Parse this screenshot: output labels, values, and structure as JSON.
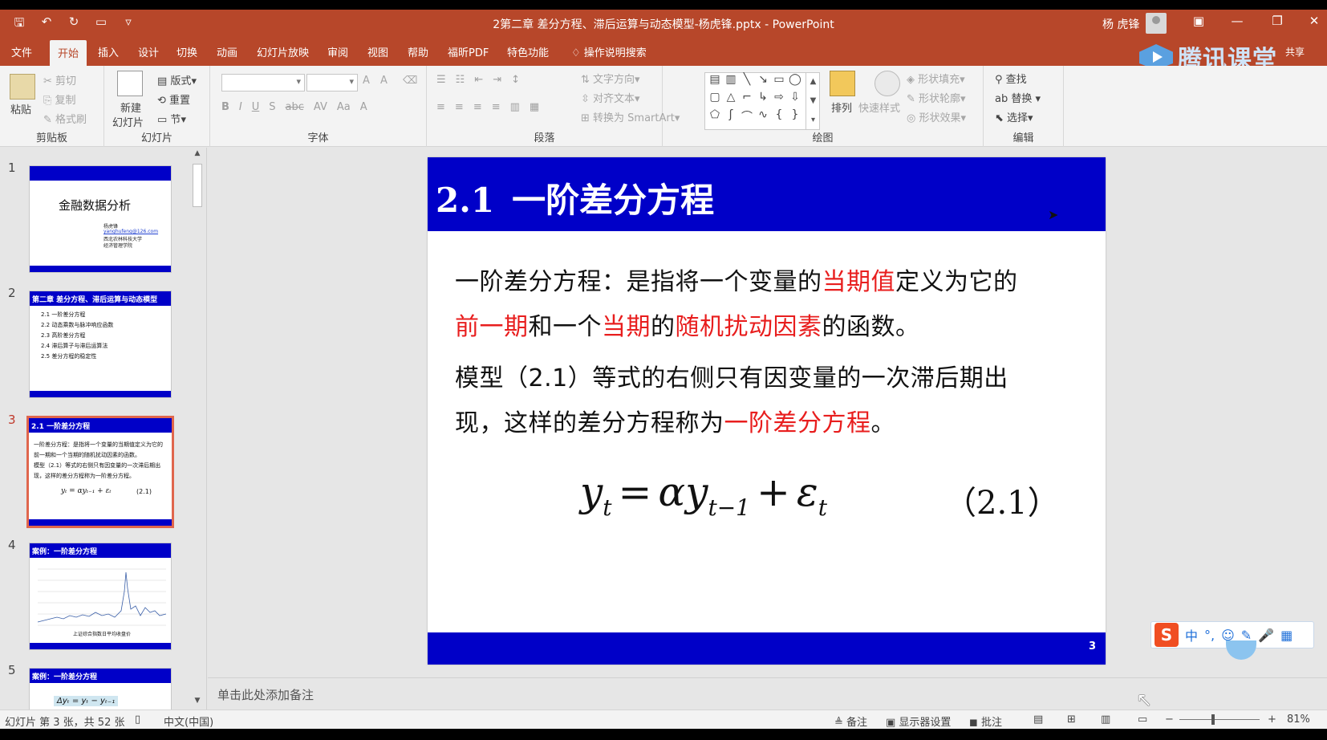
{
  "window": {
    "title": "2第二章 差分方程、滞后运算与动态模型-杨虎锋.pptx - PowerPoint",
    "user": "杨 虎锋",
    "controls": [
      "—",
      "❐",
      "✕"
    ],
    "share": "共享",
    "overlay_brand": "腾讯课堂"
  },
  "tabs": [
    "文件",
    "开始",
    "插入",
    "设计",
    "切换",
    "动画",
    "幻灯片放映",
    "审阅",
    "视图",
    "帮助",
    "福昕PDF",
    "特色功能"
  ],
  "active_tab": "开始",
  "tell_me": "操作说明搜索",
  "ribbon": {
    "clipboard": {
      "paste": "粘贴",
      "cut": "剪切",
      "copy": "复制",
      "format_painter": "格式刷",
      "label": "剪贴板"
    },
    "slides": {
      "new_slide_1": "新建",
      "new_slide_2": "幻灯片",
      "layout": "版式",
      "reset": "重置",
      "section": "节",
      "label": "幻灯片"
    },
    "font": {
      "label": "字体"
    },
    "paragraph": {
      "text_direction": "文字方向",
      "align_text": "对齐文本",
      "smartart": "转换为 SmartArt",
      "label": "段落"
    },
    "drawing": {
      "arrange": "排列",
      "quick_styles": "快速样式",
      "shape_fill": "形状填充",
      "shape_outline": "形状轮廓",
      "shape_effects": "形状效果",
      "label": "绘图"
    },
    "editing": {
      "find": "查找",
      "replace": "替换",
      "select": "选择",
      "label": "编辑"
    }
  },
  "thumbnails": [
    {
      "num": "1",
      "title": "金融数据分析",
      "meta": [
        "杨虎锋",
        "yanghufeng@126.com",
        "西北农林科技大学",
        "经济管理学院"
      ]
    },
    {
      "num": "2",
      "title": "第二章 差分方程、滞后运算与动态模型",
      "items": [
        "2.1 一阶差分方程",
        "2.2 动态乘数与脉冲响应函数",
        "2.3 高阶差分方程",
        "2.4 滞后算子与滞后运算法",
        "2.5 差分方程的稳定性"
      ]
    },
    {
      "num": "3",
      "title": "2.1 一阶差分方程",
      "lines": [
        "一阶差分方程：是指将一个变量的当期值定义为它的",
        "前一期和一个当期的随机扰动因素的函数。",
        "模型（2.1）等式的右侧只有因变量的一次滞后期出",
        "现，这样的差分方程称为一阶差分方程。"
      ],
      "formula": "yₜ = αyₜ₋₁ + εₜ",
      "eq": "(2.1)"
    },
    {
      "num": "4",
      "title": "案例：一阶差分方程",
      "caption": "上证综合指数日平均收盘价"
    },
    {
      "num": "5",
      "title": "案例：一阶差分方程",
      "formula": "Δyₜ = yₜ − yₜ₋₁"
    }
  ],
  "slide": {
    "title_num": "2.1",
    "title_text": "一阶差分方程",
    "p1_a": "一阶差分方程：是指将一个变量的",
    "p1_b": "当期值",
    "p1_c": "定义为它的",
    "p2_a": "前一期",
    "p2_b": "和一个",
    "p2_c": "当期",
    "p2_d": "的",
    "p2_e": "随机扰动因素",
    "p2_f": "的函数。",
    "p3": "模型（2.1）等式的右侧只有因变量的一次滞后期出",
    "p4_a": "现，这样的差分方程称为",
    "p4_b": "一阶差分方程",
    "p4_c": "。",
    "formula": {
      "y": "y",
      "t": "t",
      "eq": "=",
      "alpha": "α",
      "tm1": "t−1",
      "plus": "+",
      "eps": "ε"
    },
    "eq_number": "（2.1）",
    "page_number": "3"
  },
  "notes_placeholder": "单击此处添加备注",
  "status": {
    "slide_info": "幻灯片 第 3 张，共 52 张",
    "language": "中文(中国)",
    "notes": "备注",
    "display_settings": "显示器设置",
    "comments": "批注",
    "zoom": "81%"
  },
  "ime": {
    "mode": "中"
  },
  "colors": {
    "accent": "#b7472a",
    "slide_band": "#0000c8",
    "highlight_red": "#e81e1e"
  }
}
